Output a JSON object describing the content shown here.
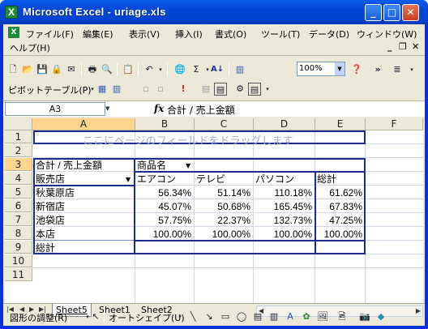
{
  "window": {
    "title": "Microsoft Excel - uriage.xls",
    "app_icon": "X"
  },
  "menubar": {
    "items": [
      "ファイル(F)",
      "編集(E)",
      "表示(V)",
      "挿入(I)",
      "書式(O)",
      "ツール(T)",
      "データ(D)",
      "ウィンドウ(W)"
    ],
    "help": "ヘルプ(H)"
  },
  "toolbar2": {
    "pivot_label": "ピボットテーブル(P)"
  },
  "toolbar1": {
    "zoom": "100%"
  },
  "formula": {
    "name_box": "A3",
    "fx": "fx",
    "content": "合計 / 売上金額"
  },
  "sheet": {
    "columns": [
      "A",
      "B",
      "C",
      "D",
      "E",
      "F"
    ],
    "rows": [
      "1",
      "2",
      "3",
      "4",
      "5",
      "6",
      "7",
      "8",
      "9",
      "10",
      "11"
    ],
    "page_field_hint": "ここにページのフィールドをドラッグします",
    "data_field": "合計 / 売上金額",
    "column_field": "商品名",
    "row_field": "販売店",
    "products": [
      "エアコン",
      "テレビ",
      "パソコン",
      "総計"
    ],
    "stores": [
      {
        "name": "秋葉原店",
        "values": [
          "56.34%",
          "51.14%",
          "110.18%",
          "61.62%"
        ]
      },
      {
        "name": "新宿店",
        "values": [
          "45.07%",
          "50.68%",
          "165.45%",
          "67.83%"
        ]
      },
      {
        "name": "池袋店",
        "values": [
          "57.75%",
          "22.37%",
          "132.73%",
          "47.25%"
        ]
      },
      {
        "name": "本店",
        "values": [
          "100.00%",
          "100.00%",
          "100.00%",
          "100.00%"
        ]
      }
    ],
    "grand_total": "総計"
  },
  "tabs": {
    "items": [
      "Sheet5",
      "Sheet1",
      "Sheet2"
    ]
  },
  "drawbar": {
    "draw_label": "図形の調整(R)",
    "autoshape_label": "オートシェイプ(U)"
  }
}
